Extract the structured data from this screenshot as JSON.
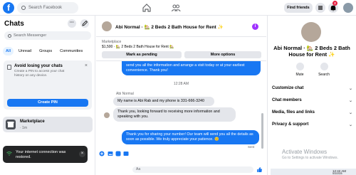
{
  "topbar": {
    "logo": "f",
    "search_placeholder": "Search Facebook",
    "find_friends": "Find friends",
    "notif_count": "2"
  },
  "left": {
    "title": "Chats",
    "dots": "···",
    "search_placeholder": "Search Messenger",
    "filters": [
      "All",
      "Unread",
      "Groups",
      "Communities"
    ],
    "avoid_title": "Avoid losing your chats",
    "avoid_sub": "Create a PIN to access your chat history on any device.",
    "avoid_close": "×",
    "create_pin": "Create PIN",
    "marketplace_name": "Marketplace",
    "marketplace_time": "· 1m"
  },
  "toast": {
    "text": "Your internet connection was restored.",
    "close": "×"
  },
  "conversation": {
    "title": "Abi Normal · 🏡 2 Beds 2 Bath House for Rent ✨",
    "info": "i",
    "listing_tag": "Marketplace",
    "listing_price": "$1,500 · 🏡 2 Beds 2 Bath House for Rent 🏡",
    "mark_pending": "Mark as pending",
    "more_options": "More options",
    "msg_top": "send you all the information and arrange a visit today or at your earliest convenience.          Thank you!",
    "timestamp": "12:28 AM",
    "sender": "Abi Normal",
    "msg_in_1": "My name is Abi Rab and my phone is 331-666-3240",
    "msg_in_2": "Thank you, looking forward to receiving more information and speaking with you.",
    "msg_out": "Thank you for sharing your number!      Our team will send you all the details as soon as possible. We truly appreciate your patience. 😊",
    "sent": "Sent",
    "input_placeholder": "Aa"
  },
  "right": {
    "name": "Abi Normal · 🏡 2 Beds 2 Bath House for Rent ✨",
    "mute": "Mute",
    "search": "Search",
    "sections": [
      "Customize chat",
      "Chat members",
      "Media, files and links",
      "Privacy & support"
    ],
    "chevron": "⌄",
    "watermark_title": "Activate Windows",
    "watermark_sub": "Go to Settings to activate Windows."
  },
  "taskbar": {
    "time": "12:42 AM",
    "date": "5/3/2025"
  },
  "colors": {
    "brand": "#1877f2",
    "bubble_out": "#1877f2",
    "bubble_in": "#e4e6eb",
    "info": "#a033ff",
    "badge": "#e41e3f"
  }
}
